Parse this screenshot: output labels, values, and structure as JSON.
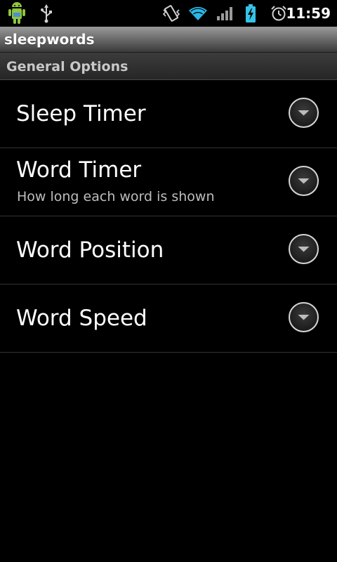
{
  "status_bar": {
    "time": "11:59",
    "icons": [
      "android-notification-icon",
      "usb-icon",
      "vibrate-icon",
      "wifi-icon",
      "signal-icon",
      "battery-charging-icon",
      "alarm-icon"
    ]
  },
  "app": {
    "title": "sleepwords"
  },
  "section": {
    "header": "General Options"
  },
  "preferences": [
    {
      "title": "Sleep Timer",
      "summary": ""
    },
    {
      "title": "Word Timer",
      "summary": "How long each word is shown"
    },
    {
      "title": "Word Position",
      "summary": ""
    },
    {
      "title": "Word Speed",
      "summary": ""
    }
  ],
  "colors": {
    "background": "#000000",
    "title_bar_gradient_top": "#9a9a9a",
    "wifi": "#2ab7e8",
    "battery": "#35c3e8",
    "text_primary": "#ffffff",
    "text_secondary": "#bdbdbd"
  }
}
